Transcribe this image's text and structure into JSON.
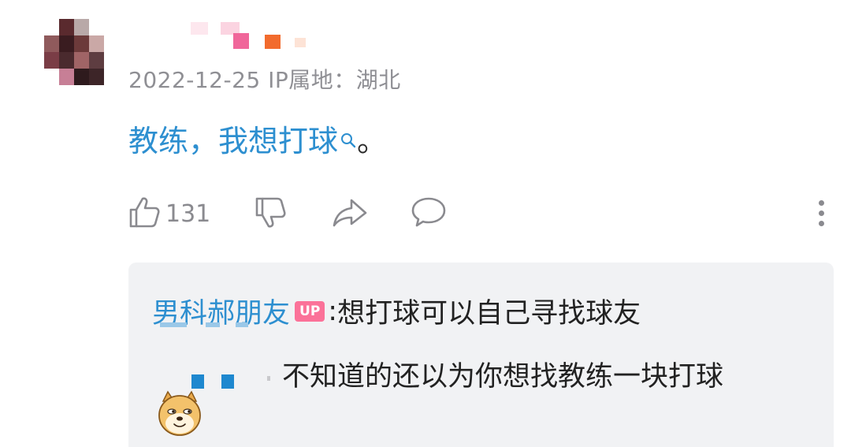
{
  "comment": {
    "timestamp": "2022-12-25",
    "ip_location": "IP属地：湖北",
    "text_link": "教练，我想打球",
    "text_suffix": "。",
    "likes": "131"
  },
  "reply": {
    "author": "男科郝朋友",
    "badge": "UP",
    "colon": ":",
    "text": "想打球可以自己寻找球友",
    "second_line": "不知道的还以为你想找教练一块打球"
  },
  "icons": {
    "like": "thumbs-up-icon",
    "dislike": "thumbs-down-icon",
    "share": "share-icon",
    "reply": "comment-bubble-icon",
    "more": "more-vertical-icon",
    "search": "search-icon",
    "emoji": "doge-emoji-icon"
  },
  "colors": {
    "link": "#2d8fd0",
    "up_badge": "#fb7299",
    "reply_bg": "#f1f2f4",
    "muted": "#8a8a8f"
  }
}
